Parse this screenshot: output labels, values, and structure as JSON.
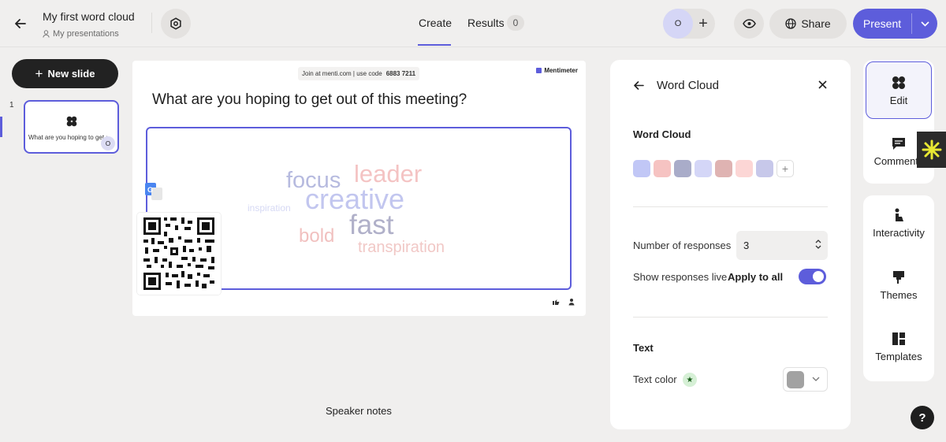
{
  "header": {
    "title": "My first word cloud",
    "breadcrumb": "My presentations",
    "tabs": [
      {
        "label": "Create",
        "active": true
      },
      {
        "label": "Results",
        "count": "0"
      }
    ],
    "collaborator_initial": "O",
    "share_label": "Share",
    "present_label": "Present"
  },
  "sidebar": {
    "new_slide_label": "New slide",
    "slides": [
      {
        "number": "1",
        "title": "What are you hoping to get out of this meeting?",
        "badge": "O"
      }
    ]
  },
  "slide": {
    "join_text": "Join at menti.com | use code",
    "join_code": "6883 7211",
    "brand": "Mentimeter",
    "question": "What are you hoping to get out of this meeting?",
    "words": [
      {
        "text": "focus",
        "color": "#b6badf"
      },
      {
        "text": "leader",
        "color": "#f4c3c3"
      },
      {
        "text": "creative",
        "color": "#c2c6ef"
      },
      {
        "text": "inspiration",
        "color": "#d6d9f4"
      },
      {
        "text": "fast",
        "color": "#b0b0c9"
      },
      {
        "text": "bold",
        "color": "#f1c0bf"
      },
      {
        "text": "transpiration",
        "color": "#f1c8c6"
      }
    ]
  },
  "speaker_notes_label": "Speaker notes",
  "panel": {
    "title": "Word Cloud",
    "section_colors_title": "Word Cloud",
    "swatch_colors": [
      "#c1c7f6",
      "#f6c3c2",
      "#a9acc9",
      "#d4d6f7",
      "#dfb3b2",
      "#fcd6d5",
      "#c7c8ea"
    ],
    "responses_label": "Number of responses",
    "responses_value": "3",
    "live_label": "Show responses live",
    "apply_all_label": "Apply to all",
    "live_on": true,
    "text_section_title": "Text",
    "text_color_label": "Text color",
    "text_color_value": "#a2a2a2"
  },
  "right_sidebar": {
    "items": [
      {
        "label": "Edit",
        "icon": "edit-icon",
        "active": true
      },
      {
        "label": "Comments",
        "icon": "comment-icon"
      },
      {
        "label": "Interactivity",
        "icon": "interactivity-icon"
      },
      {
        "label": "Themes",
        "icon": "themes-icon"
      },
      {
        "label": "Templates",
        "icon": "templates-icon"
      }
    ]
  },
  "help_label": "?",
  "colors": {
    "accent": "#5d5ddb",
    "background": "#f0efee"
  }
}
